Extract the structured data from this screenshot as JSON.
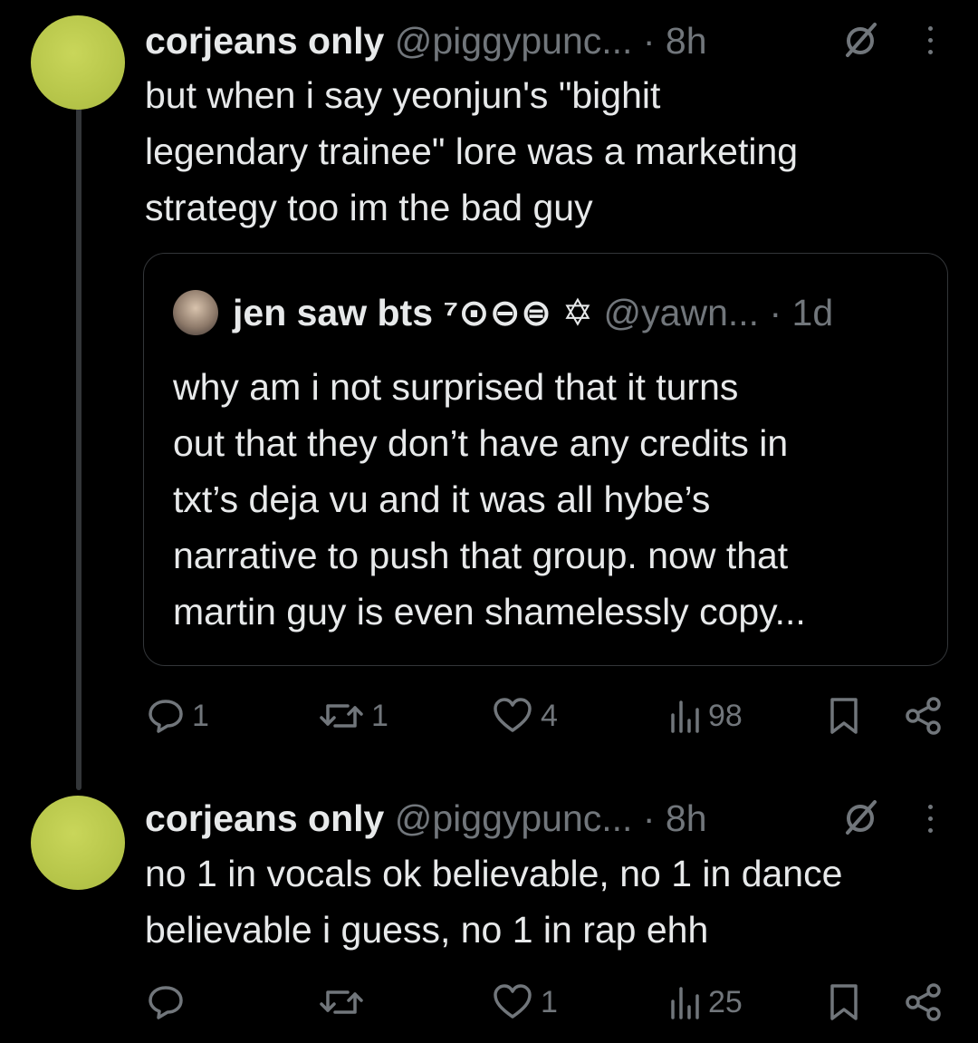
{
  "tweets": [
    {
      "author_name": "corjeans only",
      "handle": "@piggypunc...",
      "time": "· 8h",
      "text_lines": [
        "but when i say yeonjun's \"bighit",
        "legendary trainee\" lore was a marketing",
        "strategy too im the bad guy"
      ],
      "quote": {
        "author_name": "jen saw bts ⁷⊙⊖⊜ ✡",
        "handle": "@yawn...",
        "time": "· 1d",
        "text_lines": [
          "why am i not surprised that it turns",
          "out that they don’t have any credits in",
          "txt’s deja vu and it was all hybe’s",
          "narrative to push that group. now that",
          "martin guy is even shamelessly copy..."
        ]
      },
      "actions": {
        "replies": "1",
        "retweets": "1",
        "likes": "4",
        "views": "98"
      }
    },
    {
      "author_name": "corjeans only",
      "handle": "@piggypunc...",
      "time": "· 8h",
      "text_lines": [
        "no 1 in vocals ok believable, no 1 in dance",
        "believable i guess, no 1 in rap ehh"
      ],
      "actions": {
        "replies": "",
        "retweets": "",
        "likes": "1",
        "views": "25"
      }
    }
  ],
  "colors": {
    "background": "#000000",
    "text": "#e7e9ea",
    "secondary": "#71767b",
    "border": "#333639",
    "avatar": "#b7c64a"
  },
  "icons": [
    "mute-icon",
    "more-icon",
    "reply-icon",
    "retweet-icon",
    "like-icon",
    "views-icon",
    "bookmark-icon",
    "share-icon"
  ]
}
